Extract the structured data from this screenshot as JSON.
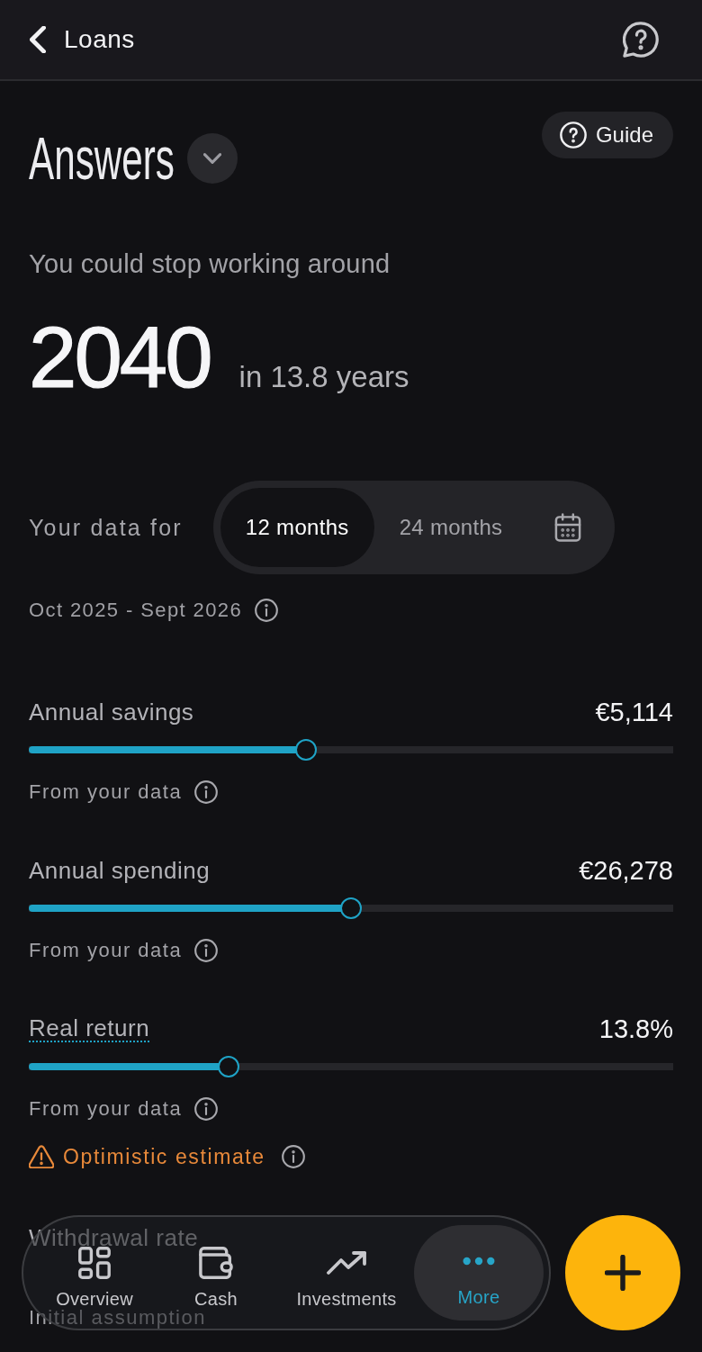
{
  "header": {
    "back_label": "Loans"
  },
  "title": "Answers",
  "guide_button": "Guide",
  "headline": {
    "intro": "You could stop working around",
    "year": "2040",
    "duration": "in 13.8 years"
  },
  "data_range": {
    "label": "Your data for",
    "periods": [
      {
        "label": "12 months",
        "selected": true
      },
      {
        "label": "24 months",
        "selected": false
      }
    ],
    "date_range": "Oct 2025 - Sept 2026"
  },
  "sliders": [
    {
      "label": "Annual savings",
      "value": "€5,114",
      "level": 0.43,
      "note": "From your data",
      "note_info": true,
      "definition": false
    },
    {
      "label": "Annual spending",
      "value": "€26,278",
      "level": 0.5,
      "note": "From your data",
      "note_info": true,
      "definition": false
    },
    {
      "label": "Real return",
      "value": "13.8%",
      "level": 0.31,
      "note": "From your data",
      "note_info": true,
      "definition": true,
      "warning": "Optimistic estimate"
    },
    {
      "label": "Withdrawal rate",
      "note": "Initial assumption",
      "note_info": false,
      "definition": false
    }
  ],
  "nav": {
    "items": [
      {
        "kind": "overview",
        "label": "Overview",
        "selected": false
      },
      {
        "kind": "cash",
        "label": "Cash",
        "selected": false
      },
      {
        "kind": "investments",
        "label": "Investments",
        "selected": false
      },
      {
        "kind": "more",
        "label": "More",
        "selected": true
      }
    ]
  }
}
